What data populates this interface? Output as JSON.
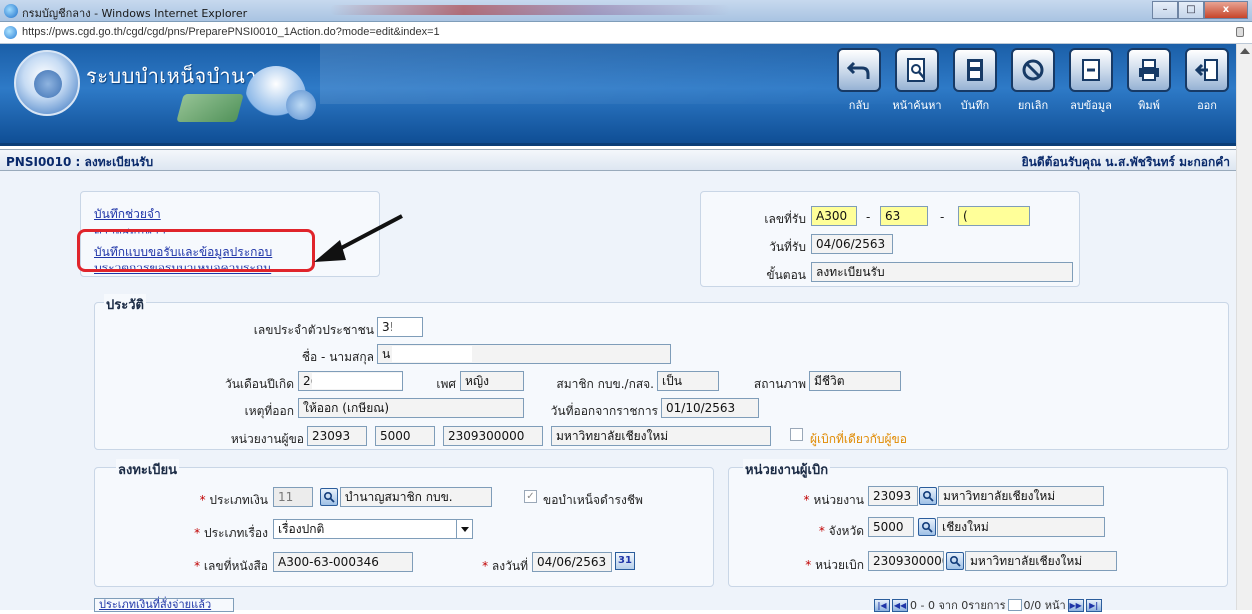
{
  "window": {
    "title": "กรมบัญชีกลาง - Windows Internet Explorer",
    "url": "https://pws.cgd.go.th/cgd/cgd/pns/PreparePNSI0010_1Action.do?mode=edit&index=1",
    "buttons": {
      "minimize": "–",
      "maximize": "□",
      "close": "x"
    }
  },
  "header": {
    "app_title": "ระบบบำเหน็จบำนาญฯ",
    "toolbar": [
      {
        "label": "กลับ",
        "icon": "back-icon"
      },
      {
        "label": "หน้าค้นหา",
        "icon": "search-page-icon"
      },
      {
        "label": "บันทึก",
        "icon": "save-icon"
      },
      {
        "label": "ยกเลิก",
        "icon": "cancel-icon"
      },
      {
        "label": "ลบข้อมูล",
        "icon": "delete-icon"
      },
      {
        "label": "พิมพ์",
        "icon": "print-icon"
      },
      {
        "label": "ออก",
        "icon": "exit-icon"
      }
    ]
  },
  "page": {
    "title": "PNSI0010 : ลงทะเบียนรับ",
    "welcome": "ยินดีต้อนรับคุณ น.ส.พัชรินทร์ มะกอกคำ"
  },
  "links": [
    "บันทึกช่วยจำ",
    "ตรวจสอบหาฯ",
    "บันทึกแบบขอรับและข้อมูลประกอบ",
    "ประวัติการขอรับบำเหน็จค้ำประกัน"
  ],
  "receipt": {
    "no_label": "เลขที่รับ",
    "no_part1": "A300",
    "sep": "-",
    "no_part2": "63",
    "no_part3": "(",
    "date_label": "วันที่รับ",
    "date_value": "04/06/2563",
    "step_label": "ขั้นตอน",
    "step_value": "ลงทะเบียนรับ"
  },
  "history": {
    "legend": "ประวัติ",
    "id_label": "เลขประจำตัวประชาชน",
    "id_value": "3!",
    "name_label": "ชื่อ - นามสกุล",
    "name_value": "น",
    "birth_label": "วันเดือนปีเกิด",
    "birth_value": "2(",
    "sex_label": "เพศ",
    "sex_value": "หญิง",
    "member_label": "สมาชิก กบข./กสจ.",
    "member_value": "เป็น",
    "status_label": "สถานภาพ",
    "status_value": "มีชีวิต",
    "reason_label": "เหตุที่ออก",
    "reason_value": "ให้ออก (เกษียณ)",
    "leave_label": "วันที่ออกจากราชการ",
    "leave_value": "01/10/2563",
    "unit_label": "หน่วยงานผู้ขอ",
    "unit_code1": "23093",
    "unit_code2": "5000",
    "unit_code3": "2309300000",
    "unit_name": "มหาวิทยาลัยเชียงใหม่",
    "same_payer_label": "ผู้เบิกที่เดียวกับผู้ขอ"
  },
  "register": {
    "legend": "ลงทะเบียน",
    "money_type_label": "ประเภทเงิน",
    "money_type_code": "11",
    "money_type_name": "บำนาญสมาชิก กบข.",
    "pension_check_label": "ขอบำเหน็จดำรงชีพ",
    "subject_type_label": "ประเภทเรื่อง",
    "subject_type_value": "เรื่องปกติ",
    "book_no_label": "เลขที่หนังสือ",
    "book_no_value": "A300-63-000346",
    "reg_date_label": "ลงวันที่",
    "reg_date_value": "04/06/2563",
    "calendar_day": "31",
    "required_mark": "*"
  },
  "payer": {
    "legend": "หน่วยงานผู้เบิก",
    "unit_label": "หน่วยงาน",
    "unit_code": "23093",
    "unit_name": "มหาวิทยาลัยเชียงใหม่",
    "province_label": "จังหวัด",
    "province_code": "5000",
    "province_name": "เชียงใหม่",
    "pay_unit_label": "หน่วยเบิก",
    "pay_unit_code": "2309300000",
    "pay_unit_name": "มหาวิทยาลัยเชียงใหม่"
  },
  "footer": {
    "tab_label": "ประเภทเงินที่สั่งจ่ายแล้ว",
    "pager_text": "0 - 0 จาก 0รายการ",
    "page_of": "0/0 หน้า"
  },
  "colors": {
    "header_blue": "#1b5fa8",
    "link": "#1f35a8",
    "annotation_red": "#e0242b",
    "highlight_yellow": "#ffff99"
  }
}
